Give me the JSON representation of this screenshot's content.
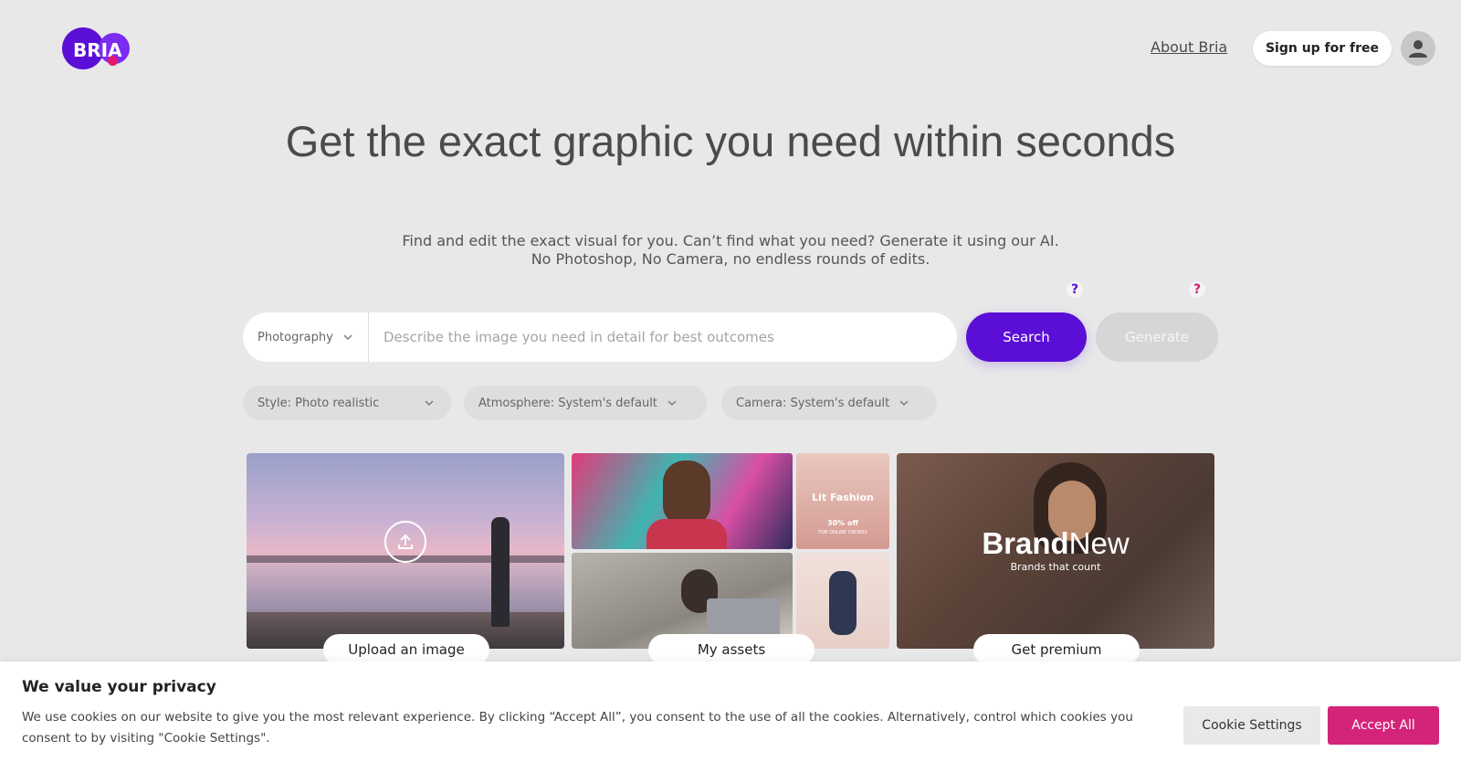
{
  "header": {
    "logo_text": "BRIA",
    "about_link": "About Bria",
    "signup_label": "Sign up for free"
  },
  "hero": {
    "title": "Get the exact graphic you need within seconds",
    "subtitle_line1": "Find and edit the exact visual for you. Can’t find what you need? Generate it using our AI.",
    "subtitle_line2": "No Photoshop, No Camera, no endless rounds of edits."
  },
  "search": {
    "category": "Photography",
    "placeholder": "Describe the image you need in detail for best outcomes",
    "search_label": "Search",
    "generate_label": "Generate",
    "help_search": "?",
    "help_generate": "?"
  },
  "filters": [
    {
      "label": "Style: Photo realistic"
    },
    {
      "label": "Atmosphere: System's default"
    },
    {
      "label": "Camera: System's default"
    }
  ],
  "tiles": {
    "upload_label": "Upload an image",
    "assets_label": "My assets",
    "premium_label": "Get premium",
    "premium_brand_bold": "Brand",
    "premium_brand_light": "New",
    "premium_brand_sub": "Brands that count",
    "assets_fashion_title": "Lit Fashion",
    "assets_fashion_offer": "30% off",
    "assets_fashion_tag": "FOR ONLINE ORDERS"
  },
  "cookie": {
    "title": "We value your privacy",
    "text": "We use cookies on our website to give you the most relevant experience. By clicking “Accept All”, you consent to the use of all the cookies. Alternatively, control which cookies you consent to by visiting \"Cookie Settings\".",
    "settings_label": "Cookie Settings",
    "accept_label": "Accept All"
  },
  "colors": {
    "brand": "#5b0fd6",
    "accent_pink": "#d4247a",
    "background": "#e8e8e9"
  }
}
